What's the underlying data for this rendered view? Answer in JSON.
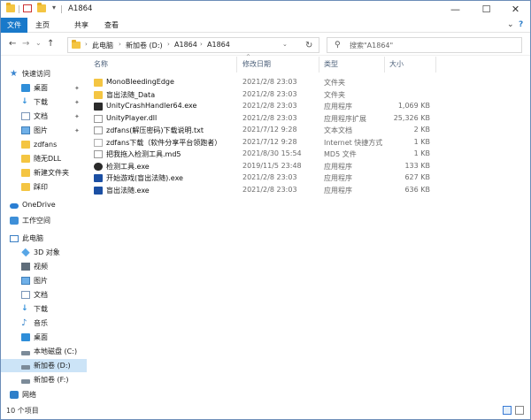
{
  "window": {
    "title": "A1864",
    "min_glyph": "—",
    "max_glyph": "☐",
    "close_glyph": "✕",
    "tab_arrow": "▾"
  },
  "ribbon": {
    "tabs": [
      "文件",
      "主页",
      "共享",
      "查看"
    ],
    "collapse_glyph": "⌄",
    "help_glyph": "?"
  },
  "navbar": {
    "back": "←",
    "forward": "→",
    "recent": "⌄",
    "up": "↑",
    "breadcrumb": [
      "此电脑",
      "新加卷 (D:)",
      "A1864",
      "A1864"
    ],
    "crumb_sep": "›",
    "dropdown": "⌄",
    "refresh": "↻",
    "search_glyph": "⚲",
    "search_placeholder": "搜索\"A1864\""
  },
  "sidebar": {
    "items": [
      {
        "label": "快速访问",
        "icon": "star-icon",
        "pinned": false
      },
      {
        "label": "桌面",
        "icon": "desktop-icon",
        "pinned": true
      },
      {
        "label": "下载",
        "icon": "download-icon",
        "pinned": true
      },
      {
        "label": "文档",
        "icon": "document-icon",
        "pinned": true
      },
      {
        "label": "图片",
        "icon": "picture-icon",
        "pinned": true
      },
      {
        "label": "zdfans",
        "icon": "folder-icon",
        "pinned": false
      },
      {
        "label": "随无DLL",
        "icon": "folder-icon",
        "pinned": false
      },
      {
        "label": "新建文件夹",
        "icon": "folder-icon",
        "pinned": false
      },
      {
        "label": "踩印",
        "icon": "folder-icon",
        "pinned": false
      },
      {
        "label": "OneDrive",
        "icon": "cloud-icon",
        "pinned": false
      },
      {
        "label": "工作空间",
        "icon": "workspace-icon",
        "pinned": false
      },
      {
        "label": "此电脑",
        "icon": "pc-icon",
        "pinned": false
      },
      {
        "label": "3D 对象",
        "icon": "3d-objects-icon",
        "pinned": false
      },
      {
        "label": "视频",
        "icon": "video-icon",
        "pinned": false
      },
      {
        "label": "图片",
        "icon": "picture-icon",
        "pinned": false
      },
      {
        "label": "文档",
        "icon": "document-icon",
        "pinned": false
      },
      {
        "label": "下载",
        "icon": "download-icon",
        "pinned": false
      },
      {
        "label": "音乐",
        "icon": "music-icon",
        "pinned": false
      },
      {
        "label": "桌面",
        "icon": "desktop-icon",
        "pinned": false
      },
      {
        "label": "本地磁盘 (C:)",
        "icon": "drive-icon",
        "pinned": false
      },
      {
        "label": "新加卷 (D:)",
        "icon": "drive-icon",
        "pinned": false,
        "selected": true
      },
      {
        "label": "新加卷 (F:)",
        "icon": "drive-icon",
        "pinned": false
      },
      {
        "label": "网络",
        "icon": "network-icon",
        "pinned": false
      }
    ],
    "pin_glyph": "✦",
    "expand_glyph": "›"
  },
  "columns": {
    "name": "名称",
    "date": "修改日期",
    "type": "类型",
    "size": "大小",
    "sort_glyph": "^"
  },
  "files": [
    {
      "name": "MonoBleedingEdge",
      "date": "2021/2/8 23:03",
      "type": "文件夹",
      "size": "",
      "icon": "folder-icon"
    },
    {
      "name": "盲出法随_Data",
      "date": "2021/2/8 23:03",
      "type": "文件夹",
      "size": "",
      "icon": "folder-icon"
    },
    {
      "name": "UnityCrashHandler64.exe",
      "date": "2021/2/8 23:03",
      "type": "应用程序",
      "size": "1,069 KB",
      "icon": "exe-icon"
    },
    {
      "name": "UnityPlayer.dll",
      "date": "2021/2/8 23:03",
      "type": "应用程序扩展",
      "size": "25,326 KB",
      "icon": "dll-icon"
    },
    {
      "name": "zdfans(解压密码)下载说明.txt",
      "date": "2021/7/12 9:28",
      "type": "文本文档",
      "size": "2 KB",
      "icon": "text-file-icon"
    },
    {
      "name": "zdfans下载（软件分享平台领跑者）",
      "date": "2021/7/12 9:28",
      "type": "Internet 快捷方式",
      "size": "1 KB",
      "icon": "shortcut-icon"
    },
    {
      "name": "把我拖入检测工具.md5",
      "date": "2021/8/30 15:54",
      "type": "MD5 文件",
      "size": "1 KB",
      "icon": "md5-file-icon"
    },
    {
      "name": "检测工具.exe",
      "date": "2019/11/5 23:48",
      "type": "应用程序",
      "size": "133 KB",
      "icon": "tool-exe-icon"
    },
    {
      "name": "开始游戏(盲出法随).exe",
      "date": "2021/2/8 23:03",
      "type": "应用程序",
      "size": "627 KB",
      "icon": "game-exe-icon"
    },
    {
      "name": "盲出法随.exe",
      "date": "2021/2/8 23:03",
      "type": "应用程序",
      "size": "636 KB",
      "icon": "game-exe-icon"
    }
  ],
  "status": {
    "count_text": "10 个项目"
  },
  "colors": {
    "accent": "#1979ca",
    "selection": "#cce4f7",
    "folder": "#f4c542"
  }
}
